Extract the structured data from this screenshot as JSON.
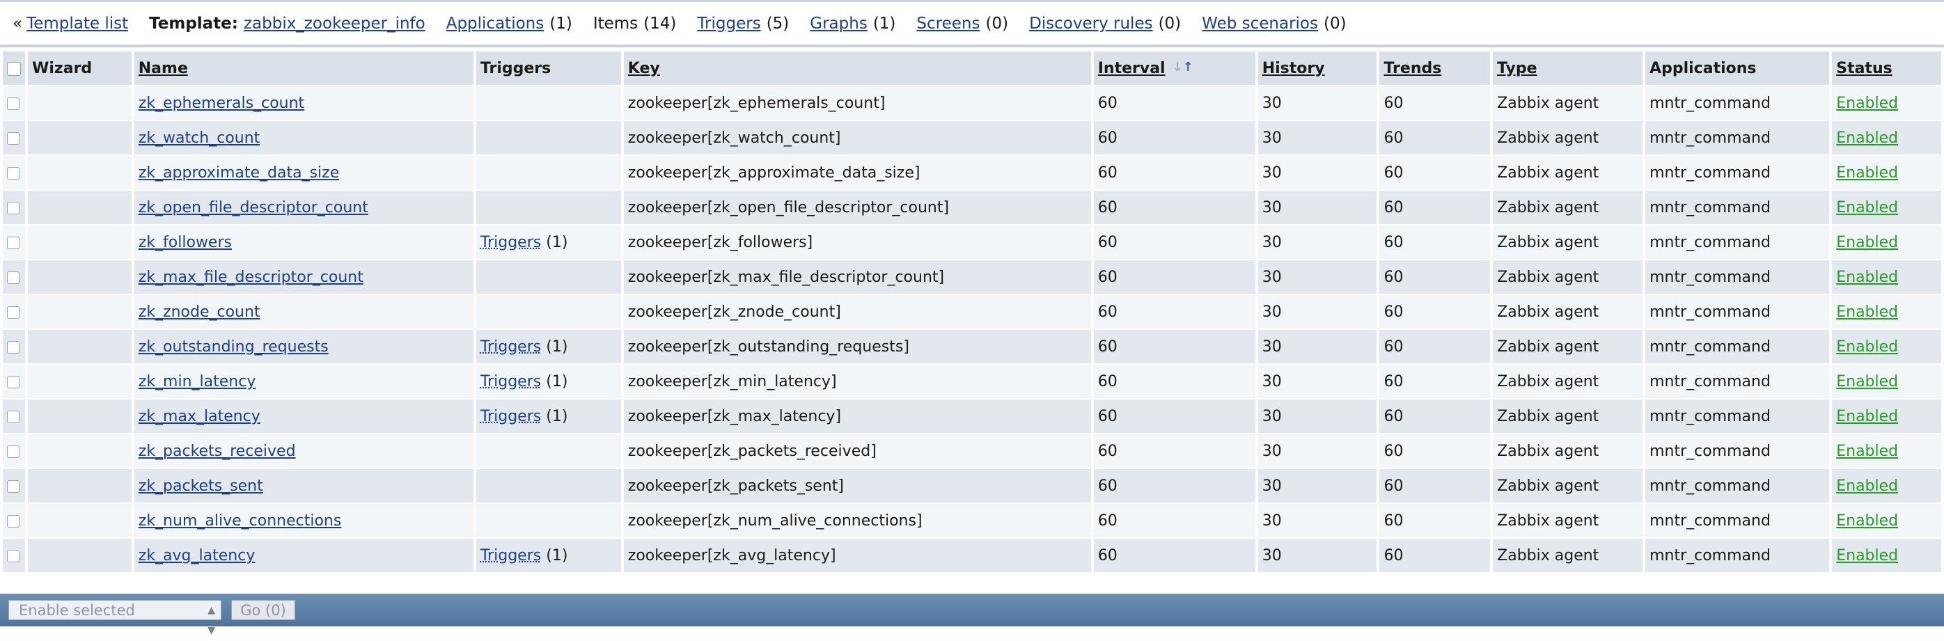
{
  "nav": {
    "template_list": "Template list",
    "template_label": "Template:",
    "template_name": "zabbix_zookeeper_info",
    "tabs": [
      {
        "label": "Applications",
        "count": "(1)",
        "link": true
      },
      {
        "label": "Items",
        "count": "(14)",
        "link": false
      },
      {
        "label": "Triggers",
        "count": "(5)",
        "link": true
      },
      {
        "label": "Graphs",
        "count": "(1)",
        "link": true
      },
      {
        "label": "Screens",
        "count": "(0)",
        "link": true
      },
      {
        "label": "Discovery rules",
        "count": "(0)",
        "link": true
      },
      {
        "label": "Web scenarios",
        "count": "(0)",
        "link": true
      }
    ]
  },
  "columns": {
    "wizard": "Wizard",
    "name": "Name",
    "triggers": "Triggers",
    "key": "Key",
    "interval": "Interval",
    "history": "History",
    "trends": "Trends",
    "type": "Type",
    "applications": "Applications",
    "status": "Status"
  },
  "rows": [
    {
      "name": "zk_ephemerals_count",
      "triggers": "",
      "trig_count": "",
      "key": "zookeeper[zk_ephemerals_count]",
      "interval": "60",
      "history": "30",
      "trends": "60",
      "type": "Zabbix agent",
      "app": "mntr_command",
      "status": "Enabled"
    },
    {
      "name": "zk_watch_count",
      "triggers": "",
      "trig_count": "",
      "key": "zookeeper[zk_watch_count]",
      "interval": "60",
      "history": "30",
      "trends": "60",
      "type": "Zabbix agent",
      "app": "mntr_command",
      "status": "Enabled"
    },
    {
      "name": "zk_approximate_data_size",
      "triggers": "",
      "trig_count": "",
      "key": "zookeeper[zk_approximate_data_size]",
      "interval": "60",
      "history": "30",
      "trends": "60",
      "type": "Zabbix agent",
      "app": "mntr_command",
      "status": "Enabled"
    },
    {
      "name": "zk_open_file_descriptor_count",
      "triggers": "",
      "trig_count": "",
      "key": "zookeeper[zk_open_file_descriptor_count]",
      "interval": "60",
      "history": "30",
      "trends": "60",
      "type": "Zabbix agent",
      "app": "mntr_command",
      "status": "Enabled"
    },
    {
      "name": "zk_followers",
      "triggers": "Triggers",
      "trig_count": "(1)",
      "key": "zookeeper[zk_followers]",
      "interval": "60",
      "history": "30",
      "trends": "60",
      "type": "Zabbix agent",
      "app": "mntr_command",
      "status": "Enabled"
    },
    {
      "name": "zk_max_file_descriptor_count",
      "triggers": "",
      "trig_count": "",
      "key": "zookeeper[zk_max_file_descriptor_count]",
      "interval": "60",
      "history": "30",
      "trends": "60",
      "type": "Zabbix agent",
      "app": "mntr_command",
      "status": "Enabled"
    },
    {
      "name": "zk_znode_count",
      "triggers": "",
      "trig_count": "",
      "key": "zookeeper[zk_znode_count]",
      "interval": "60",
      "history": "30",
      "trends": "60",
      "type": "Zabbix agent",
      "app": "mntr_command",
      "status": "Enabled"
    },
    {
      "name": "zk_outstanding_requests",
      "triggers": "Triggers",
      "trig_count": "(1)",
      "key": "zookeeper[zk_outstanding_requests]",
      "interval": "60",
      "history": "30",
      "trends": "60",
      "type": "Zabbix agent",
      "app": "mntr_command",
      "status": "Enabled"
    },
    {
      "name": "zk_min_latency",
      "triggers": "Triggers",
      "trig_count": "(1)",
      "key": "zookeeper[zk_min_latency]",
      "interval": "60",
      "history": "30",
      "trends": "60",
      "type": "Zabbix agent",
      "app": "mntr_command",
      "status": "Enabled"
    },
    {
      "name": "zk_max_latency",
      "triggers": "Triggers",
      "trig_count": "(1)",
      "key": "zookeeper[zk_max_latency]",
      "interval": "60",
      "history": "30",
      "trends": "60",
      "type": "Zabbix agent",
      "app": "mntr_command",
      "status": "Enabled"
    },
    {
      "name": "zk_packets_received",
      "triggers": "",
      "trig_count": "",
      "key": "zookeeper[zk_packets_received]",
      "interval": "60",
      "history": "30",
      "trends": "60",
      "type": "Zabbix agent",
      "app": "mntr_command",
      "status": "Enabled"
    },
    {
      "name": "zk_packets_sent",
      "triggers": "",
      "trig_count": "",
      "key": "zookeeper[zk_packets_sent]",
      "interval": "60",
      "history": "30",
      "trends": "60",
      "type": "Zabbix agent",
      "app": "mntr_command",
      "status": "Enabled"
    },
    {
      "name": "zk_num_alive_connections",
      "triggers": "",
      "trig_count": "",
      "key": "zookeeper[zk_num_alive_connections]",
      "interval": "60",
      "history": "30",
      "trends": "60",
      "type": "Zabbix agent",
      "app": "mntr_command",
      "status": "Enabled"
    },
    {
      "name": "zk_avg_latency",
      "triggers": "Triggers",
      "trig_count": "(1)",
      "key": "zookeeper[zk_avg_latency]",
      "interval": "60",
      "history": "30",
      "trends": "60",
      "type": "Zabbix agent",
      "app": "mntr_command",
      "status": "Enabled"
    }
  ],
  "footer": {
    "action_select": "Enable selected",
    "go_button": "Go (0)"
  },
  "colors": {
    "link": "#1f3f87",
    "status_enabled": "#2a9a2a",
    "header_bg": "#dbe1e8",
    "row_odd": "#f3f6f8",
    "row_even": "#e3e8ee",
    "footer_bar": "#5a7ea6"
  }
}
